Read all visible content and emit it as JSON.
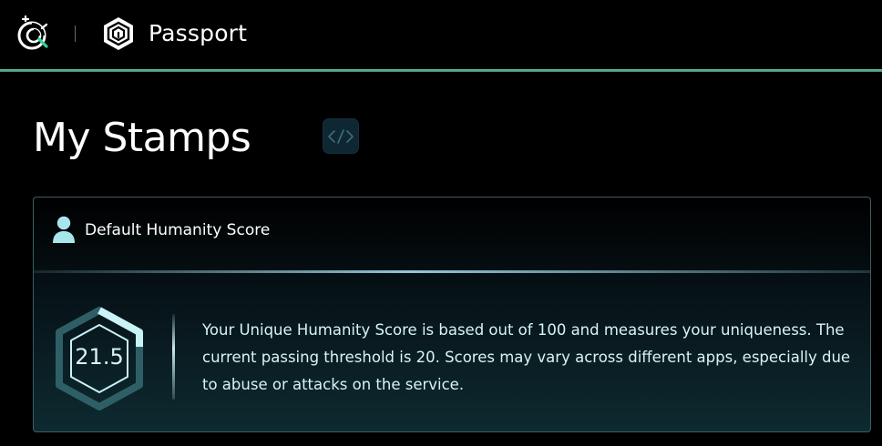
{
  "header": {
    "app_title": "Passport",
    "gitcoin_logo_icon": "gitcoin-logo-icon",
    "passport_logo_icon": "passport-logo-icon",
    "accent_line_color": "#5fae92"
  },
  "page": {
    "title": "My Stamps",
    "dev_button_icon": "code-icon",
    "dev_button_label": "</>"
  },
  "score_card": {
    "title": "Default Humanity Score",
    "title_icon": "person-icon",
    "score": "21.5",
    "score_max": 100,
    "passing_threshold": 20,
    "description": "Your Unique Humanity Score is based out of 100 and measures your uniqueness. The current passing threshold is 20. Scores may vary across different apps, especially due to abuse or attacks on the service."
  }
}
